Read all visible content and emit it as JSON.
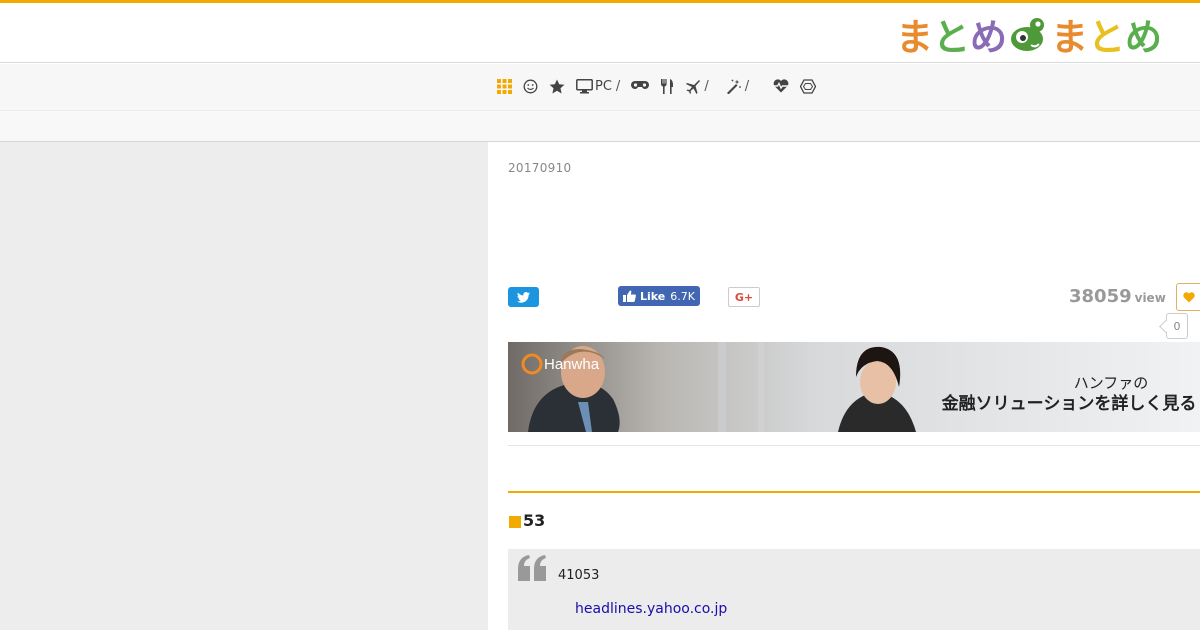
{
  "header": {
    "logo": {
      "chars": [
        "ま",
        "と",
        "め",
        "ま",
        "と",
        "め"
      ],
      "colors": [
        "#e98a2e",
        "#5aae4e",
        "#8a6bb5",
        "#e98a2e",
        "#e8c020",
        "#5aae4e"
      ]
    }
  },
  "nav": {
    "items": [
      {
        "icon": "grid-icon",
        "label": "",
        "sep": ""
      },
      {
        "icon": "smiley-icon",
        "label": "",
        "sep": ""
      },
      {
        "icon": "star-icon",
        "label": "",
        "sep": ""
      },
      {
        "icon": "monitor-icon",
        "label": "PC",
        "sep": "/"
      },
      {
        "icon": "gamepad-icon",
        "label": "",
        "sep": ""
      },
      {
        "icon": "cutlery-icon",
        "label": "",
        "sep": ""
      },
      {
        "icon": "plane-icon",
        "label": "",
        "sep": "/"
      },
      {
        "icon": "magic-wand-icon",
        "label": "",
        "sep": "/"
      },
      {
        "icon": "heartbeat-icon",
        "label": "",
        "sep": ""
      },
      {
        "icon": "hexagon-icon",
        "label": "",
        "sep": ""
      }
    ],
    "active_color": "#f2a900"
  },
  "article": {
    "date": "20170910",
    "share": {
      "facebook_like_label": "Like",
      "facebook_like_count": "6.7K",
      "google_plus_label": "G+"
    },
    "view_count": "38059",
    "view_unit": "view",
    "favorite_count": "0",
    "banner": {
      "brand": "Hanwha",
      "line1": "ハンファの",
      "line2": "金融ソリューションを詳しく見る"
    },
    "section_heading": "53",
    "quote": {
      "text": "41053",
      "link": "headlines.yahoo.co.jp"
    }
  },
  "colors": {
    "accent": "#f2a900",
    "twitter": "#1b95e0",
    "facebook": "#4267b2",
    "google_plus": "#dd4b39",
    "link": "#1a0dab"
  }
}
